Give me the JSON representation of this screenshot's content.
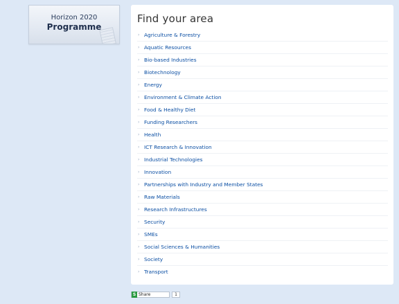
{
  "banner": {
    "line1": "Horizon 2020",
    "line2": "Programme"
  },
  "panel": {
    "title": "Find your area",
    "items": [
      {
        "label": "Agriculture & Forestry"
      },
      {
        "label": "Aquatic Resources"
      },
      {
        "label": "Bio-based Industries"
      },
      {
        "label": "Biotechnology"
      },
      {
        "label": "Energy"
      },
      {
        "label": "Environment & Climate Action"
      },
      {
        "label": "Food & Healthy Diet"
      },
      {
        "label": "Funding Researchers"
      },
      {
        "label": "Health"
      },
      {
        "label": "ICT Research & Innovation"
      },
      {
        "label": "Industrial Technologies"
      },
      {
        "label": "Innovation"
      },
      {
        "label": "Partnerships with Industry and Member States"
      },
      {
        "label": "Raw Materials"
      },
      {
        "label": "Research Infrastructures"
      },
      {
        "label": "Security"
      },
      {
        "label": "SMEs"
      },
      {
        "label": "Social Sciences & Humanities"
      },
      {
        "label": "Society"
      },
      {
        "label": "Transport"
      }
    ]
  },
  "share": {
    "label": "Share",
    "count": "1",
    "icon": "share-icon",
    "icon_color": "#2b9a42"
  },
  "colors": {
    "background": "#dde8f6",
    "link": "#0a4ea3"
  }
}
